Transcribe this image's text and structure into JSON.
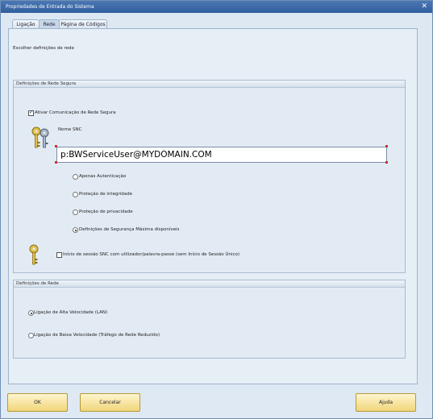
{
  "window": {
    "title": "Propriedades de Entrada do Sistema"
  },
  "tabs": [
    {
      "label": "Ligação"
    },
    {
      "label": "Rede"
    },
    {
      "label": "Página de Códigos"
    }
  ],
  "intro": "Escolher definições de rede",
  "secure_group": {
    "title": "Definições de Rede Segura",
    "activate_label": "Ativar Comunicação de Rede Segura",
    "activate_checked": true,
    "snc_name_label": "Nome SNC",
    "snc_name_value": "p:BWServiceUser@MYDOMAIN.COM",
    "options": [
      {
        "label": "Apenas Autenticação",
        "selected": false
      },
      {
        "label": "Proteção de integridade",
        "selected": false
      },
      {
        "label": "Proteção de privacidade",
        "selected": false
      },
      {
        "label": "Definições de Segurança Máxima disponíveis",
        "selected": true
      }
    ],
    "snc_login_label": "Início de sessão SNC com utilizador/palavra-passe (sem Início de Sessão Único)",
    "snc_login_checked": false
  },
  "network_group": {
    "title": "Definições de Rede",
    "options": [
      {
        "label": "Ligação de Alta Velocidade (LAN)",
        "selected": true
      },
      {
        "label": "Ligação de Baixa Velocidade (Tráfego de Rede Reduzido)",
        "selected": false
      }
    ]
  },
  "buttons": {
    "ok": "OK",
    "cancel": "Cancelar",
    "help": "Ajuda"
  },
  "icons": [
    "keys-icon",
    "key-icon",
    "close-icon"
  ]
}
